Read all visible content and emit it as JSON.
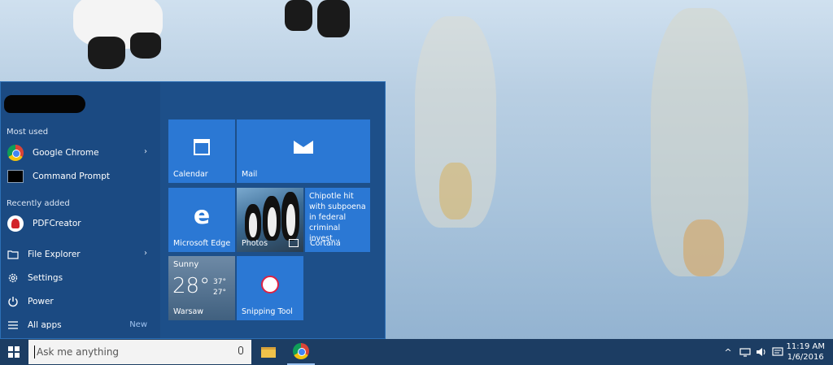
{
  "start_menu": {
    "most_used_label": "Most used",
    "recently_added_label": "Recently added",
    "most_used": [
      {
        "label": "Google Chrome",
        "icon": "chrome-icon"
      },
      {
        "label": "Command Prompt",
        "icon": "command-prompt-icon"
      }
    ],
    "recently_added": [
      {
        "label": "PDFCreator",
        "icon": "pdfcreator-icon"
      }
    ],
    "system": [
      {
        "label": "File Explorer",
        "icon": "file-explorer-icon"
      },
      {
        "label": "Settings",
        "icon": "gear-icon"
      },
      {
        "label": "Power",
        "icon": "power-icon"
      },
      {
        "label": "All apps",
        "icon": "list-icon"
      }
    ],
    "all_apps_badge": "New",
    "tiles": {
      "calendar": "Calendar",
      "mail": "Mail",
      "edge": "Microsoft Edge",
      "photos": "Photos",
      "cortana_headline": "Chipotle hit with subpoena in federal criminal invest...",
      "cortana": "Cortana",
      "weather_condition": "Sunny",
      "weather_temp": "28°",
      "weather_high": "37°",
      "weather_low": "27°",
      "weather_city": "Warsaw",
      "snipping": "Snipping Tool"
    }
  },
  "taskbar": {
    "search_placeholder": "Ask me anything",
    "apps": [
      "File Explorer",
      "Google Chrome"
    ],
    "clock_time": "11:19 AM",
    "clock_date": "1/6/2016"
  }
}
